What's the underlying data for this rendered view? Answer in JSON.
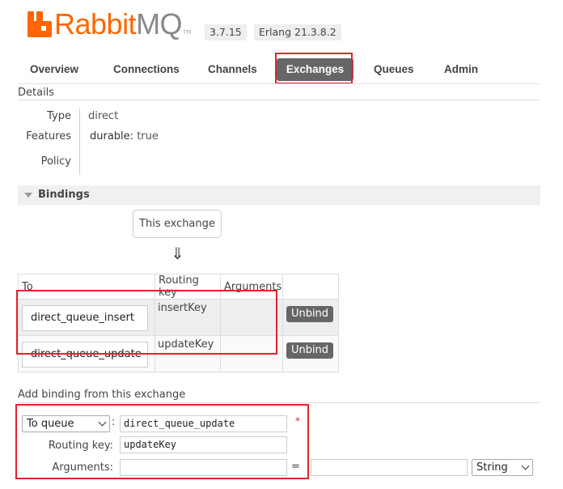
{
  "header": {
    "logo_rabbit": "Rabbit",
    "logo_mq": "MQ",
    "logo_tm": "TM",
    "version": "3.7.15",
    "erlang": "Erlang 21.3.8.2",
    "brand_color": "#ff6600"
  },
  "nav": {
    "tabs": [
      {
        "label": "Overview"
      },
      {
        "label": "Connections"
      },
      {
        "label": "Channels"
      },
      {
        "label": "Exchanges",
        "active": true
      },
      {
        "label": "Queues"
      },
      {
        "label": "Admin"
      }
    ]
  },
  "details": {
    "title": "Details",
    "type_label": "Type",
    "type_value": "direct",
    "features_label": "Features",
    "features_key": "durable:",
    "features_value": "true",
    "policy_label": "Policy"
  },
  "bindings": {
    "title": "Bindings",
    "this_exchange": "This exchange",
    "arrow": "⇓",
    "columns": [
      "To",
      "Routing key",
      "Arguments",
      ""
    ],
    "rows": [
      {
        "to": "direct_queue_insert",
        "routing_key": "insertKey",
        "arguments": "",
        "action": "Unbind"
      },
      {
        "to": "direct_queue_update",
        "routing_key": "updateKey",
        "arguments": "",
        "action": "Unbind"
      }
    ]
  },
  "add_binding": {
    "title": "Add binding from this exchange",
    "destination_type": "To queue",
    "destination_value": "direct_queue_update",
    "required_mark": "*",
    "routing_key_label": "Routing key:",
    "routing_key_value": "updateKey",
    "arguments_label": "Arguments:",
    "arguments_key": "",
    "equals": "=",
    "arguments_value": "",
    "arguments_type": "String",
    "colon": ":"
  },
  "highlight_color": "#e0242e"
}
